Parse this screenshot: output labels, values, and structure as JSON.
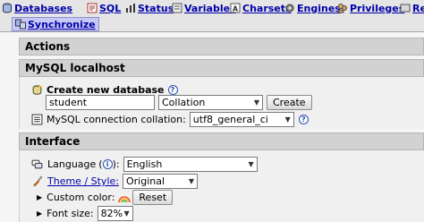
{
  "tabs": [
    {
      "label": "Databases",
      "icon": "database-icon"
    },
    {
      "label": "SQL",
      "icon": "sql-icon"
    },
    {
      "label": "Status",
      "icon": "status-icon"
    },
    {
      "label": "Variables",
      "icon": "variables-icon"
    },
    {
      "label": "Charsets",
      "icon": "charsets-icon"
    },
    {
      "label": "Engines",
      "icon": "engines-icon"
    },
    {
      "label": "Privileges",
      "icon": "privileges-icon"
    },
    {
      "label": "Rep",
      "icon": "replication-icon"
    }
  ],
  "sync_tab": {
    "label": "Synchronize",
    "icon": "synchronize-icon"
  },
  "actions": {
    "title": "Actions"
  },
  "mysql": {
    "title": "MySQL localhost",
    "create_db": {
      "label": "Create new database",
      "value": "student",
      "collation_selected": "Collation",
      "create_label": "Create"
    },
    "connection_collation": {
      "label": "MySQL connection collation:",
      "value": "utf8_general_ci"
    }
  },
  "interface": {
    "title": "Interface",
    "language": {
      "label": "Language",
      "value": "English"
    },
    "theme": {
      "label": "Theme / Style:",
      "value": "Original"
    },
    "custom_color": {
      "label": "Custom color:",
      "reset_label": "Reset"
    },
    "font_size": {
      "label": "Font size:",
      "value": "82%"
    }
  },
  "colors": {
    "link": "#0000aa",
    "section_header": "#d2d2d2",
    "active_tab": "#c9c9f5"
  }
}
